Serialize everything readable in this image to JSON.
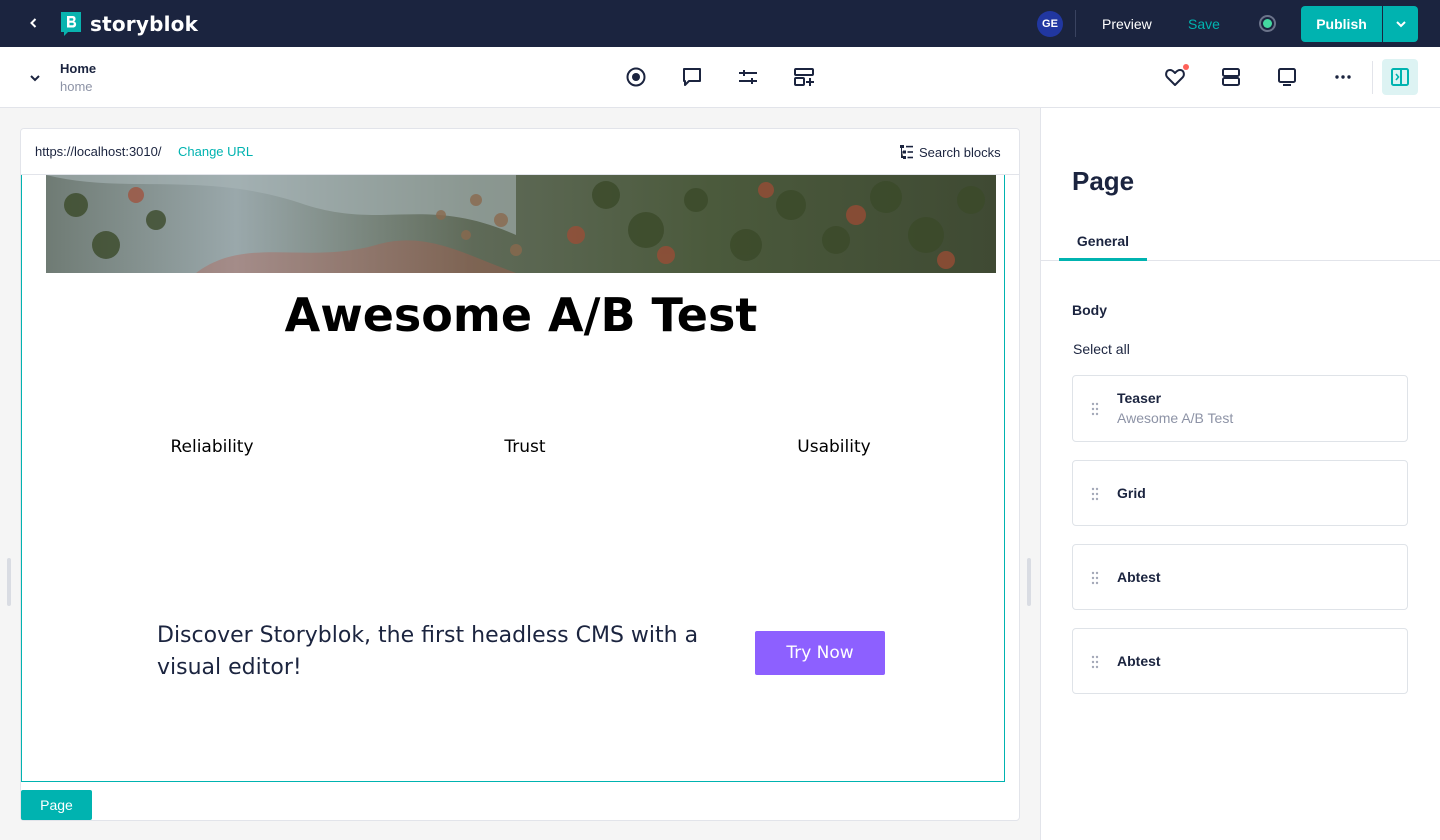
{
  "topbar": {
    "logo_text": "storyblok",
    "avatar_initials": "GE",
    "preview_label": "Preview",
    "save_label": "Save",
    "publish_label": "Publish"
  },
  "toolbar": {
    "story_name": "Home",
    "story_slug": "home"
  },
  "preview": {
    "url": "https://localhost:3010/",
    "change_url_label": "Change URL",
    "search_blocks_label": "Search blocks",
    "headline": "Awesome A/B Test",
    "features": [
      "Reliability",
      "Trust",
      "Usability"
    ],
    "teaser_text": "Discover Storyblok, the first headless CMS with a visual editor!",
    "cta_label": "Try Now",
    "page_tag_label": "Page"
  },
  "panel": {
    "title": "Page",
    "tabs": [
      {
        "label": "General",
        "active": true
      }
    ],
    "body_label": "Body",
    "select_all_label": "Select all",
    "blocks": [
      {
        "name": "Teaser",
        "subtitle": "Awesome A/B Test"
      },
      {
        "name": "Grid",
        "subtitle": ""
      },
      {
        "name": "Abtest",
        "subtitle": ""
      },
      {
        "name": "Abtest",
        "subtitle": ""
      }
    ]
  },
  "colors": {
    "topbar_bg": "#1b243f",
    "accent": "#00b3b0",
    "cta": "#8d60ff"
  }
}
